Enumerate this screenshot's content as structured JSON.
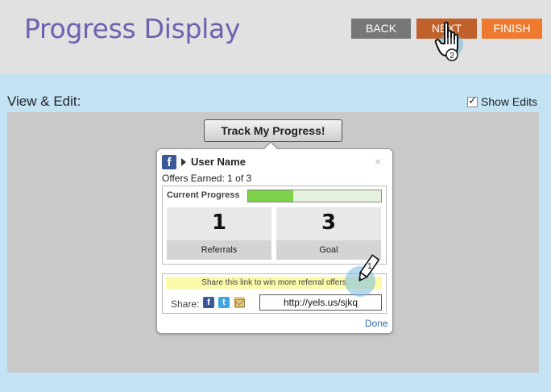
{
  "header": {
    "title": "Progress Display",
    "buttons": {
      "back": "BACK",
      "next": "NEXT",
      "finish": "FINISH"
    },
    "cursor_step": "2"
  },
  "section": {
    "title": "View & Edit:",
    "show_edits_label": "Show Edits",
    "show_edits_checked": true
  },
  "widget": {
    "track_button": "Track My Progress!",
    "user_name": "User Name",
    "close": "×",
    "offers_earned": "Offers Earned: 1 of 3",
    "progress_label": "Current Progress",
    "progress_fraction": 0.34,
    "referrals_value": "1",
    "referrals_label": "Referrals",
    "goal_value": "3",
    "goal_label": "Goal",
    "share_banner": "Share this link to win more referral offers",
    "share_label": "Share:",
    "share_icons": [
      "facebook-icon",
      "twitter-icon",
      "email-icon"
    ],
    "share_url": "http://yels.us/sjkq",
    "done_label": "Done",
    "edit_step": "1"
  },
  "colors": {
    "title": "#7060b0",
    "back": "#777777",
    "next": "#c0602a",
    "finish": "#ee7a30",
    "progress_fill": "#7dd148",
    "background": "#c3e3f5"
  }
}
